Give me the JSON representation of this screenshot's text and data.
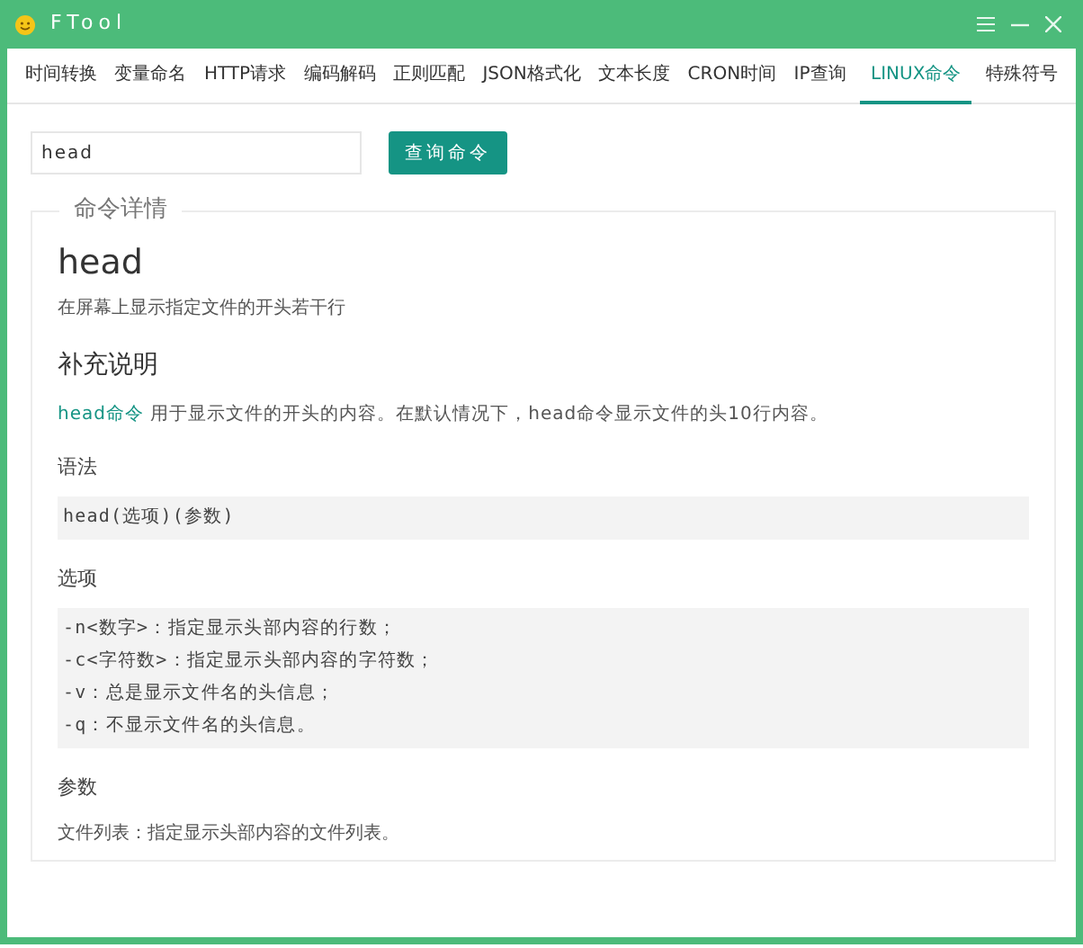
{
  "window": {
    "title": "FTool"
  },
  "tabs": [
    {
      "label": "时间转换",
      "selected": false
    },
    {
      "label": "变量命名",
      "selected": false
    },
    {
      "label": "HTTP请求",
      "selected": false
    },
    {
      "label": "编码解码",
      "selected": false
    },
    {
      "label": "正则匹配",
      "selected": false
    },
    {
      "label": "JSON格式化",
      "selected": false
    },
    {
      "label": "文本长度",
      "selected": false
    },
    {
      "label": "CRON时间",
      "selected": false
    },
    {
      "label": "IP查询",
      "selected": false
    },
    {
      "label": "LINUX命令",
      "selected": true
    },
    {
      "label": "特殊符号",
      "selected": false
    }
  ],
  "search": {
    "value": "head",
    "button": "查询命令"
  },
  "details": {
    "legend": "命令详情",
    "name": "head",
    "summary": "在屏幕上显示指定文件的开头若干行",
    "blocks": [
      {
        "kind": "heading",
        "text": "补充说明"
      },
      {
        "kind": "paragraph",
        "link": "head命令",
        "text": " 用于显示文件的开头的内容。在默认情况下，head命令显示文件的头10行内容。"
      },
      {
        "kind": "subheading",
        "text": "语法"
      },
      {
        "kind": "code",
        "lines": [
          "head(选项)(参数)"
        ]
      },
      {
        "kind": "subheading",
        "text": "选项"
      },
      {
        "kind": "code",
        "lines": [
          "-n<数字>：指定显示头部内容的行数；",
          "-c<字符数>：指定显示头部内容的字符数；",
          "-v：总是显示文件名的头信息；",
          "-q：不显示文件名的头信息。"
        ]
      },
      {
        "kind": "subheading",
        "text": "参数"
      },
      {
        "kind": "plain",
        "text": "文件列表：指定显示头部内容的文件列表。"
      }
    ]
  }
}
